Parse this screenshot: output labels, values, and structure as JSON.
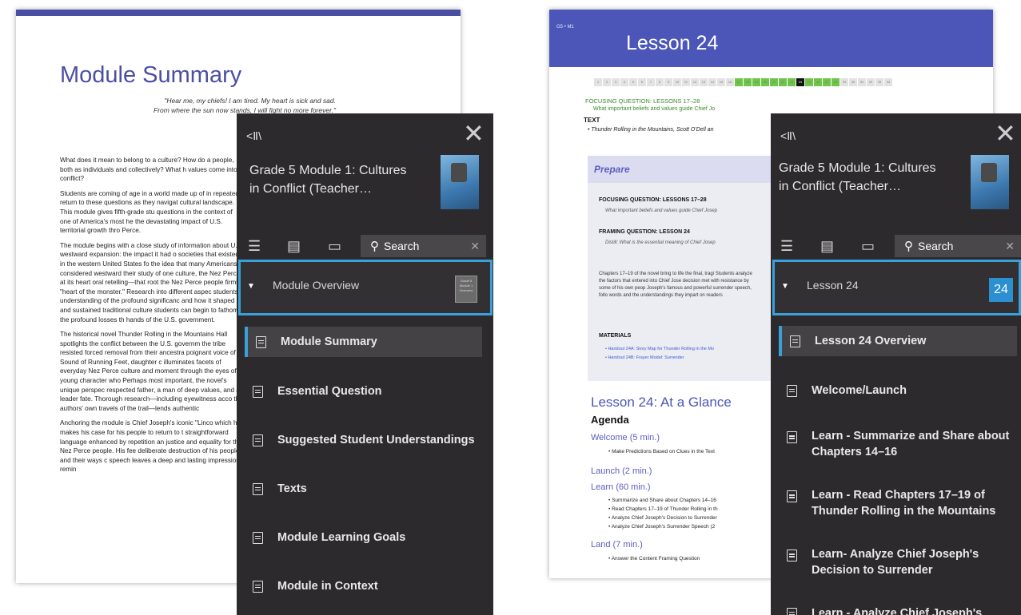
{
  "left_document": {
    "title": "Module Summary",
    "quote_line1": "\"Hear me, my chiefs! I am tired. My heart is sick and sad.",
    "quote_line2": "From where the sun now stands, I will fight no more forever.\"",
    "paragraphs": [
      "What does it mean to belong to a culture? How do a people, both as individuals and collectively? What h values come into conflict?",
      "Students are coming of age in a world made up of in repeatedly return to these questions as they navigat cultural landscape. This module gives fifth-grade stu questions in the context of one of America's most he the devastating impact of U.S. territorial growth thro Perce.",
      "The module begins with a close study of information about U.S. westward expansion: the impact it had o societies that existed in the western United States fo the idea that many Americans considered westward their study of one culture, the Nez Perce, at its heart oral retelling—that root the Nez Perce people firmly \"heart of the monster.\" Research into different aspec students' understanding of the profound significanc and how it shaped and sustained traditional culture students can begin to fathom the profound losses th hands of the U.S. government.",
      "The historical novel Thunder Rolling in the Mountains Hall spotlights the conflict between the U.S. governm the tribe resisted forced removal from their ancestra poignant voice of Sound of Running Feet, daughter c illuminates facets of everyday Nez Perce culture and moment through the eyes of a young character who Perhaps most important, the novel's unique perspec respected father, a man of deep values, and a leader fate. Thorough research—including eyewitness acco the authors' own travels of the trail—lends authentic",
      "Anchoring the module is Chief Joseph's iconic \"Linco which he makes his case for his people to return to t straightforward language enhanced by repetition an justice and equality for the Nez Perce people. His fee deliberate destruction of his people and their ways c speech leaves a deep and lasting impression, remin"
    ]
  },
  "right_document": {
    "grade_tag": "G5 • M1",
    "title": "Lesson 24",
    "progress_labels": [
      "1",
      "2",
      "3",
      "4",
      "5",
      "6",
      "7",
      "8",
      "9",
      "10",
      "11",
      "12",
      "13",
      "14",
      "15",
      "16",
      "17",
      "18",
      "19",
      "20",
      "21",
      "22",
      "23",
      "24",
      "25",
      "26",
      "27",
      "28",
      "29",
      "30",
      "31",
      "32",
      "33",
      "34"
    ],
    "focusing_label": "FOCUSING QUESTION: LESSONS 17–28",
    "focusing_sub": "What important beliefs and values guide Chief Jo",
    "text_heading": "TEXT",
    "text_item": "• Thunder Rolling in the Mountains, Scott O'Dell an",
    "prepare": {
      "title": "Prepare",
      "fq_label": "FOCUSING QUESTION: LESSONS 17–28",
      "fq_text": "What important beliefs and values guide Chief Josep",
      "framing_label": "FRAMING QUESTION: LESSON 24",
      "framing_text": "Distill: What is the essential meaning of Chief Josep",
      "paragraph": "Chapters 17–19 of the novel bring to life the final, tragi Students analyze the factors that entered into Chief Jose decision met with resistance by some of his own peop Joseph's famous and powerful surrender speech, follo words and the understandings they impart on readers",
      "materials_label": "MATERIALS",
      "material_1": "• Handout 24A: Story Map for Thunder Rolling in the Mo",
      "material_2": "• Handout 24B: Frayer Model: Surrender"
    },
    "glance_title": "Lesson 24: At a Glance",
    "agenda_title": "Agenda",
    "welcome": "Welcome (5 min.)",
    "welcome_item": "• Make Predictions Based on Clues in the Text",
    "launch": "Launch (2 min.)",
    "learn": "Learn (60 min.)",
    "learn_items": [
      "• Summarize and Share about Chapters 14–16",
      "• Read Chapters 17–19 of Thunder Rolling in th",
      "• Analyze Chief Joseph's Decision to Surrender",
      "• Analyze Chief Joseph's Surrender Speech (2"
    ],
    "land": "Land (7 min.)",
    "land_item": "• Answer the Content Framing Question"
  },
  "panel_left": {
    "logo": "<Ⅱ\\",
    "close": "✕",
    "book_title_line1": "Grade 5 Module 1: Cultures",
    "book_title_line2": "in Conflict (Teacher…",
    "search_label": "Search",
    "section_label": "Module Overview",
    "section_thumb": "Grade 5 Module 1 Overview",
    "items": [
      "Module Summary",
      "Essential Question",
      "Suggested Student Understandings",
      "Texts",
      "Module Learning Goals",
      "Module in Context"
    ]
  },
  "panel_right": {
    "logo": "<Ⅱ\\",
    "close": "✕",
    "book_title_line1": "Grade 5 Module 1: Cultures",
    "book_title_line2": "in Conflict (Teacher…",
    "search_label": "Search",
    "section_label": "Lesson 24",
    "section_badge": "24",
    "items": [
      {
        "line1": "Lesson 24 Overview",
        "line2": ""
      },
      {
        "line1": "Welcome/Launch",
        "line2": ""
      },
      {
        "line1": "Learn - Summarize and Share about",
        "line2": "Chapters 14–16"
      },
      {
        "line1": "Learn - Read Chapters 17–19 of",
        "line2": "Thunder Rolling in the Mountains"
      },
      {
        "line1": "Learn- Analyze Chief Joseph's",
        "line2": "Decision to Surrender"
      },
      {
        "line1": "Learn - Analyze Chief Joseph's",
        "line2": ""
      }
    ]
  },
  "colors": {
    "accent_blue": "#4b56b8",
    "highlight_border": "#39a0d9",
    "panel_bg": "#2d2a2e",
    "progress_green": "#6fc44a"
  }
}
